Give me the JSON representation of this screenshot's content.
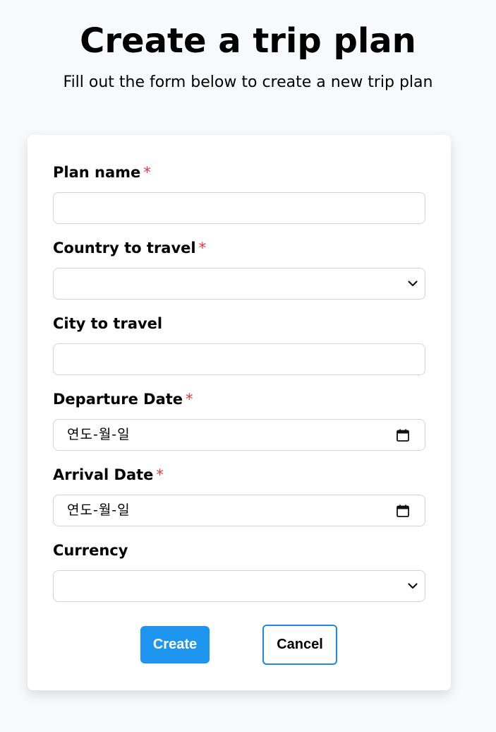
{
  "header": {
    "title": "Create a trip plan",
    "subtitle": "Fill out the form below to create a new trip plan"
  },
  "form": {
    "plan_name": {
      "label": "Plan name",
      "required_mark": "*",
      "value": ""
    },
    "country": {
      "label": "Country to travel",
      "required_mark": "*",
      "selected": ""
    },
    "city": {
      "label": "City to travel",
      "value": ""
    },
    "departure_date": {
      "label": "Departure Date",
      "required_mark": "*",
      "placeholder": "연도-월-일"
    },
    "arrival_date": {
      "label": "Arrival Date",
      "required_mark": "*",
      "placeholder": "연도-월-일"
    },
    "currency": {
      "label": "Currency",
      "selected": ""
    }
  },
  "actions": {
    "create_label": "Create",
    "cancel_label": "Cancel"
  },
  "colors": {
    "primary": "#1e96f0",
    "required": "#e53935",
    "background": "#f8f9fb"
  }
}
